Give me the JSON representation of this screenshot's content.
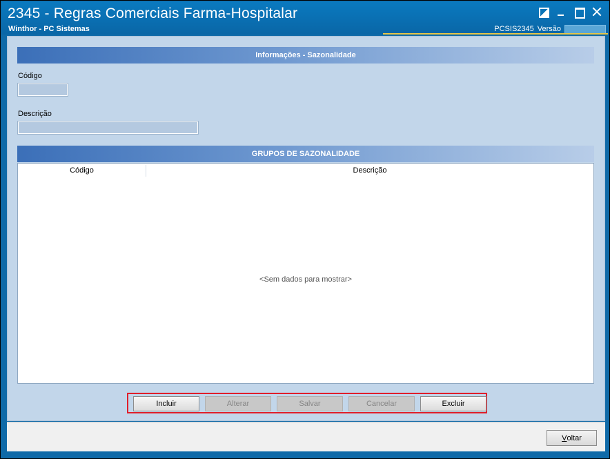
{
  "window": {
    "title": "2345 - Regras Comerciais Farma-Hospitalar",
    "subtitle": "Winthor - PC Sistemas",
    "program_code": "PCSIS2345",
    "version_label": "Versão"
  },
  "info_section": {
    "header": "Informações - Sazonalidade",
    "codigo_label": "Código",
    "codigo_value": "",
    "descricao_label": "Descrição",
    "descricao_value": ""
  },
  "groups_section": {
    "header": "GRUPOS DE SAZONALIDADE",
    "columns": [
      "Código",
      "Descrição"
    ],
    "rows": [],
    "empty_text": "<Sem dados para mostrar>"
  },
  "actions": {
    "incluir": "Incluir",
    "alterar": "Alterar",
    "salvar": "Salvar",
    "cancelar": "Cancelar",
    "excluir": "Excluir"
  },
  "footer": {
    "voltar_first": "V",
    "voltar_rest": "oltar"
  },
  "colors": {
    "titlebar": "#0a6fb2",
    "panel": "#c2d6ea",
    "highlight_border": "#e01e2a"
  }
}
